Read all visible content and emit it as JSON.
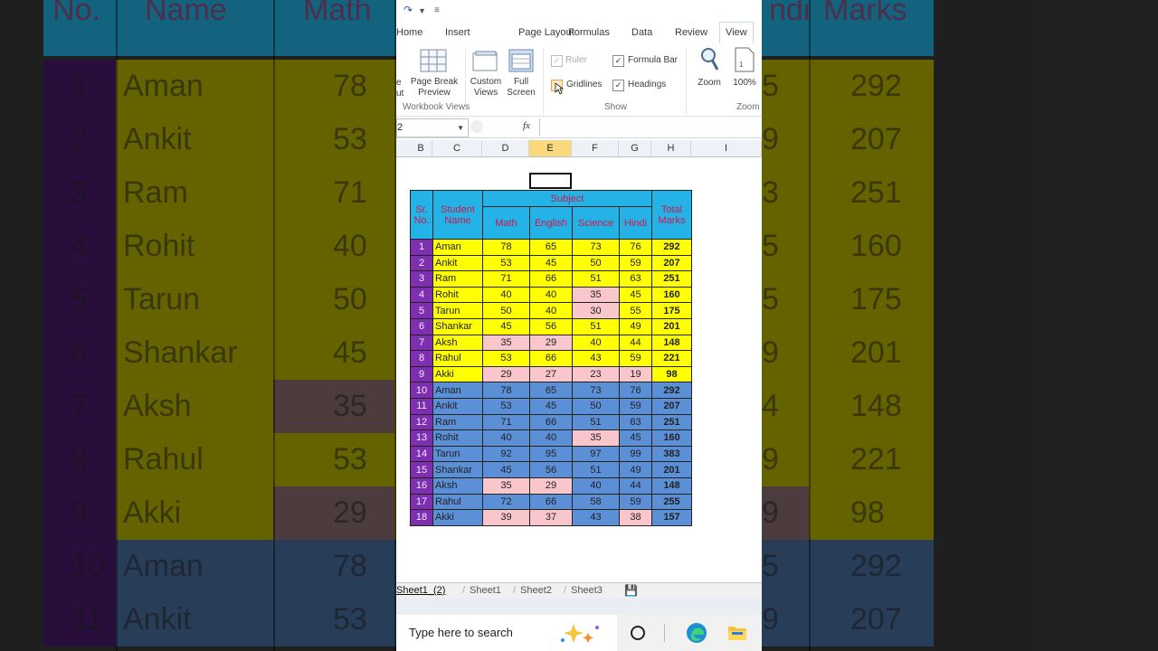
{
  "app": {
    "tabs": [
      "Home",
      "Insert",
      "Page Layout",
      "Formulas",
      "Data",
      "Review",
      "View"
    ],
    "active_tab": "View"
  },
  "ribbon": {
    "page_break_preview": "Page Break\nPreview",
    "custom_views": "Custom\nViews",
    "full_screen": "Full\nScreen",
    "workbook_views_group": "Workbook Views",
    "ruler": "Ruler",
    "formula_bar": "Formula Bar",
    "gridlines": "Gridlines",
    "headings": "Headings",
    "show_group": "Show",
    "zoom": "Zoom",
    "zoom_100": "100%",
    "zoom_group": "Zoom",
    "partial_left": "e",
    "partial_left2": "ut",
    "ruler_checked": true,
    "formula_bar_checked": true,
    "gridlines_checked": false,
    "headings_checked": true
  },
  "formula_bar": {
    "name_box": "2",
    "fx": "fx"
  },
  "columns": [
    "B",
    "C",
    "D",
    "E",
    "F",
    "G",
    "H",
    "I"
  ],
  "selected_column": "E",
  "table": {
    "header_sr": "Sr.\nNo.",
    "header_name": "Student\nName",
    "header_subject": "Subject",
    "header_total": "Total\nMarks",
    "subjects": [
      "Math",
      "English",
      "Science",
      "Hindi"
    ],
    "rows": [
      {
        "sr": "1",
        "name": "Aman",
        "marks": [
          "78",
          "65",
          "73",
          "76"
        ],
        "total": "292"
      },
      {
        "sr": "2",
        "name": "Ankit",
        "marks": [
          "53",
          "45",
          "50",
          "59"
        ],
        "total": "207"
      },
      {
        "sr": "3",
        "name": "Ram",
        "marks": [
          "71",
          "66",
          "51",
          "63"
        ],
        "total": "251"
      },
      {
        "sr": "4",
        "name": "Rohit",
        "marks": [
          "40",
          "40",
          "35",
          "45"
        ],
        "total": "160"
      },
      {
        "sr": "5",
        "name": "Tarun",
        "marks": [
          "50",
          "40",
          "30",
          "55"
        ],
        "total": "175"
      },
      {
        "sr": "6",
        "name": "Shankar",
        "marks": [
          "45",
          "56",
          "51",
          "49"
        ],
        "total": "201"
      },
      {
        "sr": "7",
        "name": "Aksh",
        "marks": [
          "35",
          "29",
          "40",
          "44"
        ],
        "total": "148"
      },
      {
        "sr": "8",
        "name": "Rahul",
        "marks": [
          "53",
          "66",
          "43",
          "59"
        ],
        "total": "221"
      },
      {
        "sr": "9",
        "name": "Akki",
        "marks": [
          "29",
          "27",
          "23",
          "19"
        ],
        "total": "98"
      },
      {
        "sr": "10",
        "name": "Aman",
        "marks": [
          "78",
          "65",
          "73",
          "76"
        ],
        "total": "292"
      },
      {
        "sr": "11",
        "name": "Ankit",
        "marks": [
          "53",
          "45",
          "50",
          "59"
        ],
        "total": "207"
      },
      {
        "sr": "12",
        "name": "Ram",
        "marks": [
          "71",
          "66",
          "51",
          "63"
        ],
        "total": "251"
      },
      {
        "sr": "13",
        "name": "Rohit",
        "marks": [
          "40",
          "40",
          "35",
          "45"
        ],
        "total": "160"
      },
      {
        "sr": "14",
        "name": "Tarun",
        "marks": [
          "92",
          "95",
          "97",
          "99"
        ],
        "total": "383"
      },
      {
        "sr": "15",
        "name": "Shankar",
        "marks": [
          "45",
          "56",
          "51",
          "49"
        ],
        "total": "201"
      },
      {
        "sr": "16",
        "name": "Aksh",
        "marks": [
          "35",
          "29",
          "40",
          "44"
        ],
        "total": "148"
      },
      {
        "sr": "17",
        "name": "Rahul",
        "marks": [
          "72",
          "66",
          "58",
          "59"
        ],
        "total": "255"
      },
      {
        "sr": "18",
        "name": "Akki",
        "marks": [
          "39",
          "37",
          "43",
          "38"
        ],
        "total": "157"
      }
    ]
  },
  "colors": {
    "purple": "#7d2fb0",
    "yellow": "#ffff00",
    "blue": "#5b8fd6",
    "pink": "#f9c6cc",
    "header_cyan": "#23b3e6",
    "header_text": "#d4144e"
  },
  "sheets": [
    "Sheet1_(2)",
    "Sheet1",
    "Sheet2",
    "Sheet3"
  ],
  "active_sheet": "Sheet1_(2)",
  "taskbar": {
    "search_placeholder": "Type here to search"
  },
  "background": {
    "headers": [
      "No.",
      "Name",
      "Math",
      "ndi",
      "Marks"
    ],
    "rows": [
      {
        "sr": "1",
        "name": "Aman",
        "math": "78",
        "hindi": "5",
        "total": "292"
      },
      {
        "sr": "2",
        "name": "Ankit",
        "math": "53",
        "hindi": "9",
        "total": "207"
      },
      {
        "sr": "3",
        "name": "Ram",
        "math": "71",
        "hindi": "3",
        "total": "251"
      },
      {
        "sr": "4",
        "name": "Rohit",
        "math": "40",
        "hindi": "5",
        "total": "160"
      },
      {
        "sr": "5",
        "name": "Tarun",
        "math": "50",
        "hindi": "5",
        "total": "175"
      },
      {
        "sr": "6",
        "name": "Shankar",
        "math": "45",
        "hindi": "9",
        "total": "201"
      },
      {
        "sr": "7",
        "name": "Aksh",
        "math": "35",
        "hindi": "4",
        "total": "148"
      },
      {
        "sr": "8",
        "name": "Rahul",
        "math": "53",
        "hindi": "9",
        "total": "221"
      },
      {
        "sr": "9",
        "name": "Akki",
        "math": "29",
        "hindi": "9",
        "total": "98"
      },
      {
        "sr": "10",
        "name": "Aman",
        "math": "78",
        "hindi": "5",
        "total": "292"
      },
      {
        "sr": "11",
        "name": "Ankit",
        "math": "53",
        "hindi": "9",
        "total": "207"
      }
    ]
  }
}
